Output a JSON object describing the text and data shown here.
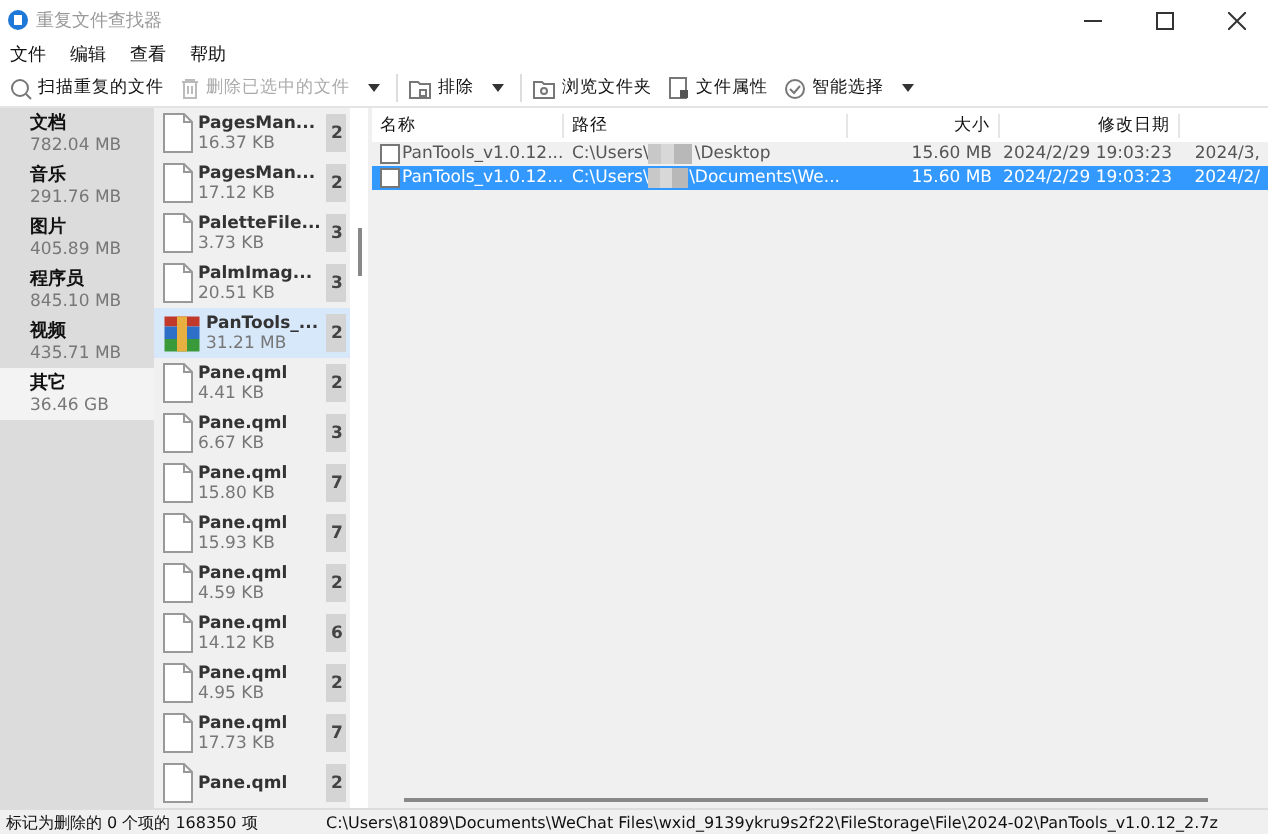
{
  "window": {
    "title": "重复文件查找器"
  },
  "menu": [
    "文件",
    "编辑",
    "查看",
    "帮助"
  ],
  "toolbar": [
    {
      "kind": "search",
      "label": "扫描重复的文件",
      "disabled": false,
      "dropdown": false
    },
    {
      "kind": "trash",
      "label": "删除已选中的文件",
      "disabled": true,
      "dropdown": true
    },
    {
      "kind": "exclude",
      "label": "排除",
      "disabled": false,
      "dropdown": true
    },
    {
      "kind": "folder",
      "label": "浏览文件夹",
      "disabled": false,
      "dropdown": false
    },
    {
      "kind": "properties",
      "label": "文件属性",
      "disabled": false,
      "dropdown": false
    },
    {
      "kind": "smart",
      "label": "智能选择",
      "disabled": false,
      "dropdown": true
    }
  ],
  "categories": [
    {
      "name": "文档",
      "size": "782.04 MB",
      "selected": false
    },
    {
      "name": "音乐",
      "size": "291.76 MB",
      "selected": false
    },
    {
      "name": "图片",
      "size": "405.89 MB",
      "selected": false
    },
    {
      "name": "程序员",
      "size": "845.10 MB",
      "selected": false
    },
    {
      "name": "视频",
      "size": "435.71 MB",
      "selected": false
    },
    {
      "name": "其它",
      "size": "36.46 GB",
      "selected": true
    }
  ],
  "files": [
    {
      "kind": "doc",
      "name": "PagesMan...",
      "size": "16.37 KB",
      "count": "2",
      "selected": false
    },
    {
      "kind": "doc",
      "name": "PagesMan...",
      "size": "17.12 KB",
      "count": "2",
      "selected": false
    },
    {
      "kind": "doc",
      "name": "PaletteFile...",
      "size": "3.73 KB",
      "count": "3",
      "selected": false
    },
    {
      "kind": "doc",
      "name": "PalmImag...",
      "size": "20.51 KB",
      "count": "3",
      "selected": false
    },
    {
      "kind": "archive",
      "name": "PanTools_...",
      "size": "31.21 MB",
      "count": "2",
      "selected": true
    },
    {
      "kind": "doc",
      "name": "Pane.qml",
      "size": "4.41 KB",
      "count": "2",
      "selected": false
    },
    {
      "kind": "doc",
      "name": "Pane.qml",
      "size": "6.67 KB",
      "count": "3",
      "selected": false
    },
    {
      "kind": "doc",
      "name": "Pane.qml",
      "size": "15.80 KB",
      "count": "7",
      "selected": false
    },
    {
      "kind": "doc",
      "name": "Pane.qml",
      "size": "15.93 KB",
      "count": "7",
      "selected": false
    },
    {
      "kind": "doc",
      "name": "Pane.qml",
      "size": "4.59 KB",
      "count": "2",
      "selected": false
    },
    {
      "kind": "doc",
      "name": "Pane.qml",
      "size": "14.12 KB",
      "count": "6",
      "selected": false
    },
    {
      "kind": "doc",
      "name": "Pane.qml",
      "size": "4.95 KB",
      "count": "2",
      "selected": false
    },
    {
      "kind": "doc",
      "name": "Pane.qml",
      "size": "17.73 KB",
      "count": "7",
      "selected": false
    },
    {
      "kind": "doc",
      "name": "Pane.qml",
      "count": "2",
      "selected": false
    }
  ],
  "table": {
    "columns": [
      "名称",
      "路径",
      "大小",
      "修改日期"
    ],
    "rows": [
      {
        "name": "PanTools_v1.0.12...",
        "path_start": "C:\\Users\\",
        "path_end": "\\Desktop",
        "size": "15.60 MB",
        "modified": "2024/2/29 19:03:23",
        "column_5": "2024/3,",
        "checked": false,
        "selected": false
      },
      {
        "name": "PanTools_v1.0.12...",
        "path_start": "C:\\Users\\",
        "path_end": "\\Documents\\We...",
        "size": "15.60 MB",
        "modified": "2024/2/29 19:03:23",
        "column_5": "2024/2/",
        "checked": false,
        "selected": true
      }
    ]
  },
  "status_bar": {
    "marked": "标记为删除的 0 个项的 168350 项",
    "path": "C:\\Users\\81089\\Documents\\WeChat Files\\wxid_9139ykru9s2f22\\FileStorage\\File\\2024-02\\PanTools_v1.0.12_2.7z"
  }
}
